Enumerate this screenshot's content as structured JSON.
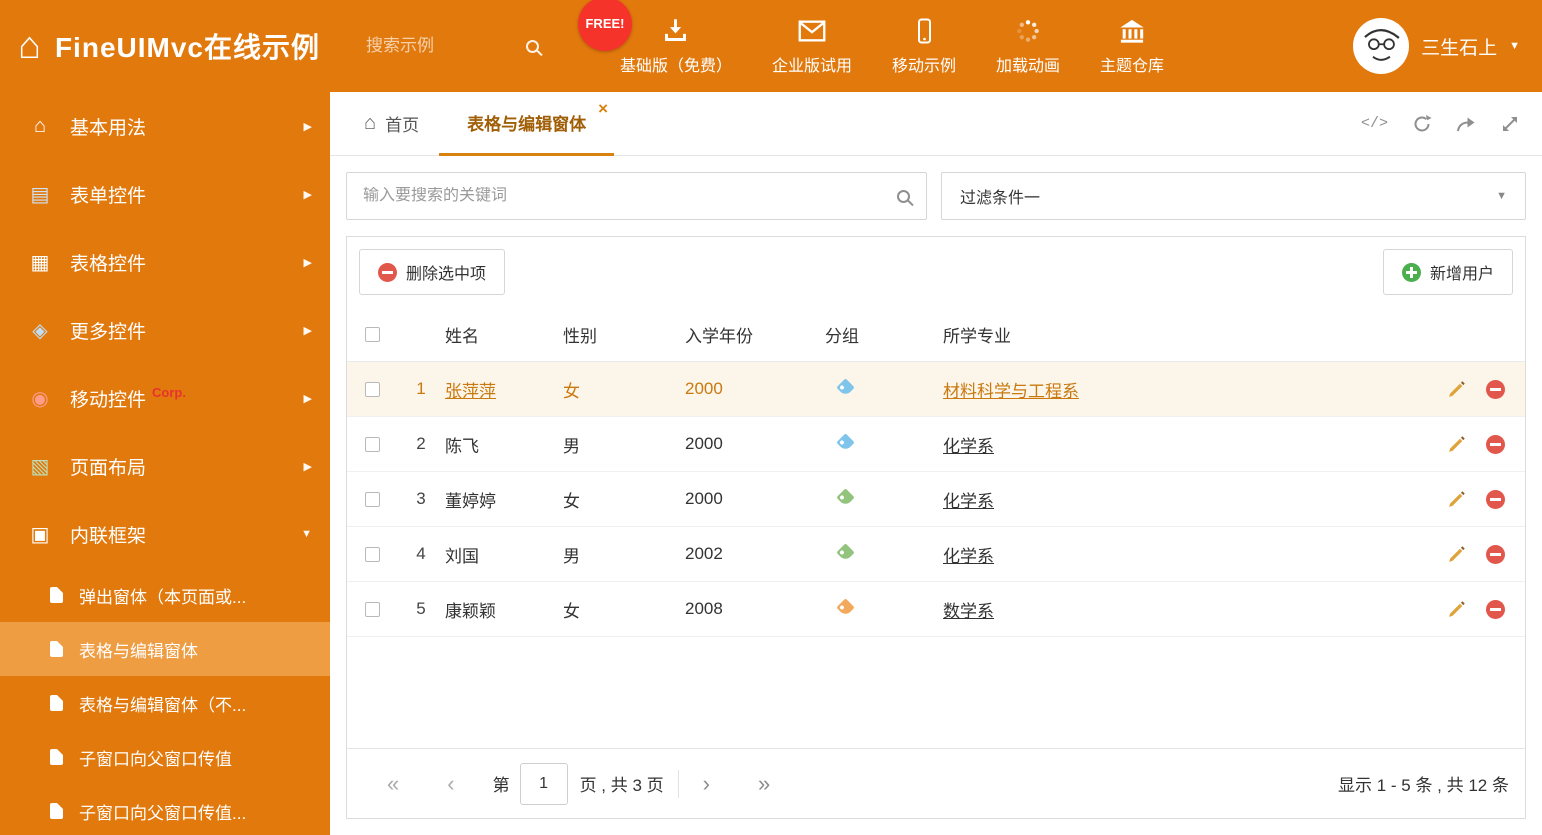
{
  "colors": {
    "theme_orange": "#E2790D",
    "sidebar_active_bg": "#EF9D43",
    "active_tab_text": "#A05E06",
    "selected_row_text": "#C9790F",
    "selected_row_bg": "#FCF5E9",
    "free_badge_red": "#F5332B",
    "delete_red": "#E2574C",
    "add_green": "#4BAE4F",
    "pencil_orange": "#E0A33A"
  },
  "header": {
    "title": "FineUIMvc在线示例",
    "search_placeholder": "搜索示例",
    "free_badge": "FREE!",
    "nav_items": [
      {
        "label": "基础版（免费）",
        "icon": "download-icon"
      },
      {
        "label": "企业版试用",
        "icon": "mail-icon"
      },
      {
        "label": "移动示例",
        "icon": "mobile-icon"
      },
      {
        "label": "加载动画",
        "icon": "spinner-icon"
      },
      {
        "label": "主题仓库",
        "icon": "bank-icon"
      }
    ],
    "user_name": "三生石上"
  },
  "sidebar": {
    "items": [
      {
        "label": "基本用法"
      },
      {
        "label": "表单控件"
      },
      {
        "label": "表格控件"
      },
      {
        "label": "更多控件"
      },
      {
        "label": "移动控件",
        "badge": "Corp."
      },
      {
        "label": "页面布局"
      },
      {
        "label": "内联框架",
        "expanded": true
      }
    ],
    "subitems": [
      {
        "label": "弹出窗体（本页面或..."
      },
      {
        "label": "表格与编辑窗体",
        "active": true
      },
      {
        "label": "表格与编辑窗体（不..."
      },
      {
        "label": "子窗口向父窗口传值"
      },
      {
        "label": "子窗口向父窗口传值..."
      }
    ]
  },
  "tabs": {
    "home_label": "首页",
    "active_label": "表格与编辑窗体"
  },
  "filters": {
    "search_placeholder": "输入要搜索的关键词",
    "dropdown_value": "过滤条件一"
  },
  "toolbar": {
    "delete_label": "删除选中项",
    "add_label": "新增用户"
  },
  "table": {
    "headers": {
      "name": "姓名",
      "gender": "性别",
      "year": "入学年份",
      "group": "分组",
      "major": "所学专业"
    },
    "rows": [
      {
        "num": "1",
        "name": "张萍萍",
        "gender": "女",
        "year": "2000",
        "tag_color": "#7FC4EA",
        "major": "材料科学与工程系",
        "selected": true
      },
      {
        "num": "2",
        "name": "陈飞",
        "gender": "男",
        "year": "2000",
        "tag_color": "#7FC4EA",
        "major": "化学系"
      },
      {
        "num": "3",
        "name": "董婷婷",
        "gender": "女",
        "year": "2000",
        "tag_color": "#93C47D",
        "major": "化学系"
      },
      {
        "num": "4",
        "name": "刘国",
        "gender": "男",
        "year": "2002",
        "tag_color": "#93C47D",
        "major": "化学系"
      },
      {
        "num": "5",
        "name": "康颖颖",
        "gender": "女",
        "year": "2008",
        "tag_color": "#F3A95C",
        "major": "数学系"
      }
    ]
  },
  "pagination": {
    "page_prefix": "第",
    "page_value": "1",
    "page_suffix": "页 , 共 3 页",
    "summary": "显示 1 - 5 条 , 共 12 条"
  }
}
